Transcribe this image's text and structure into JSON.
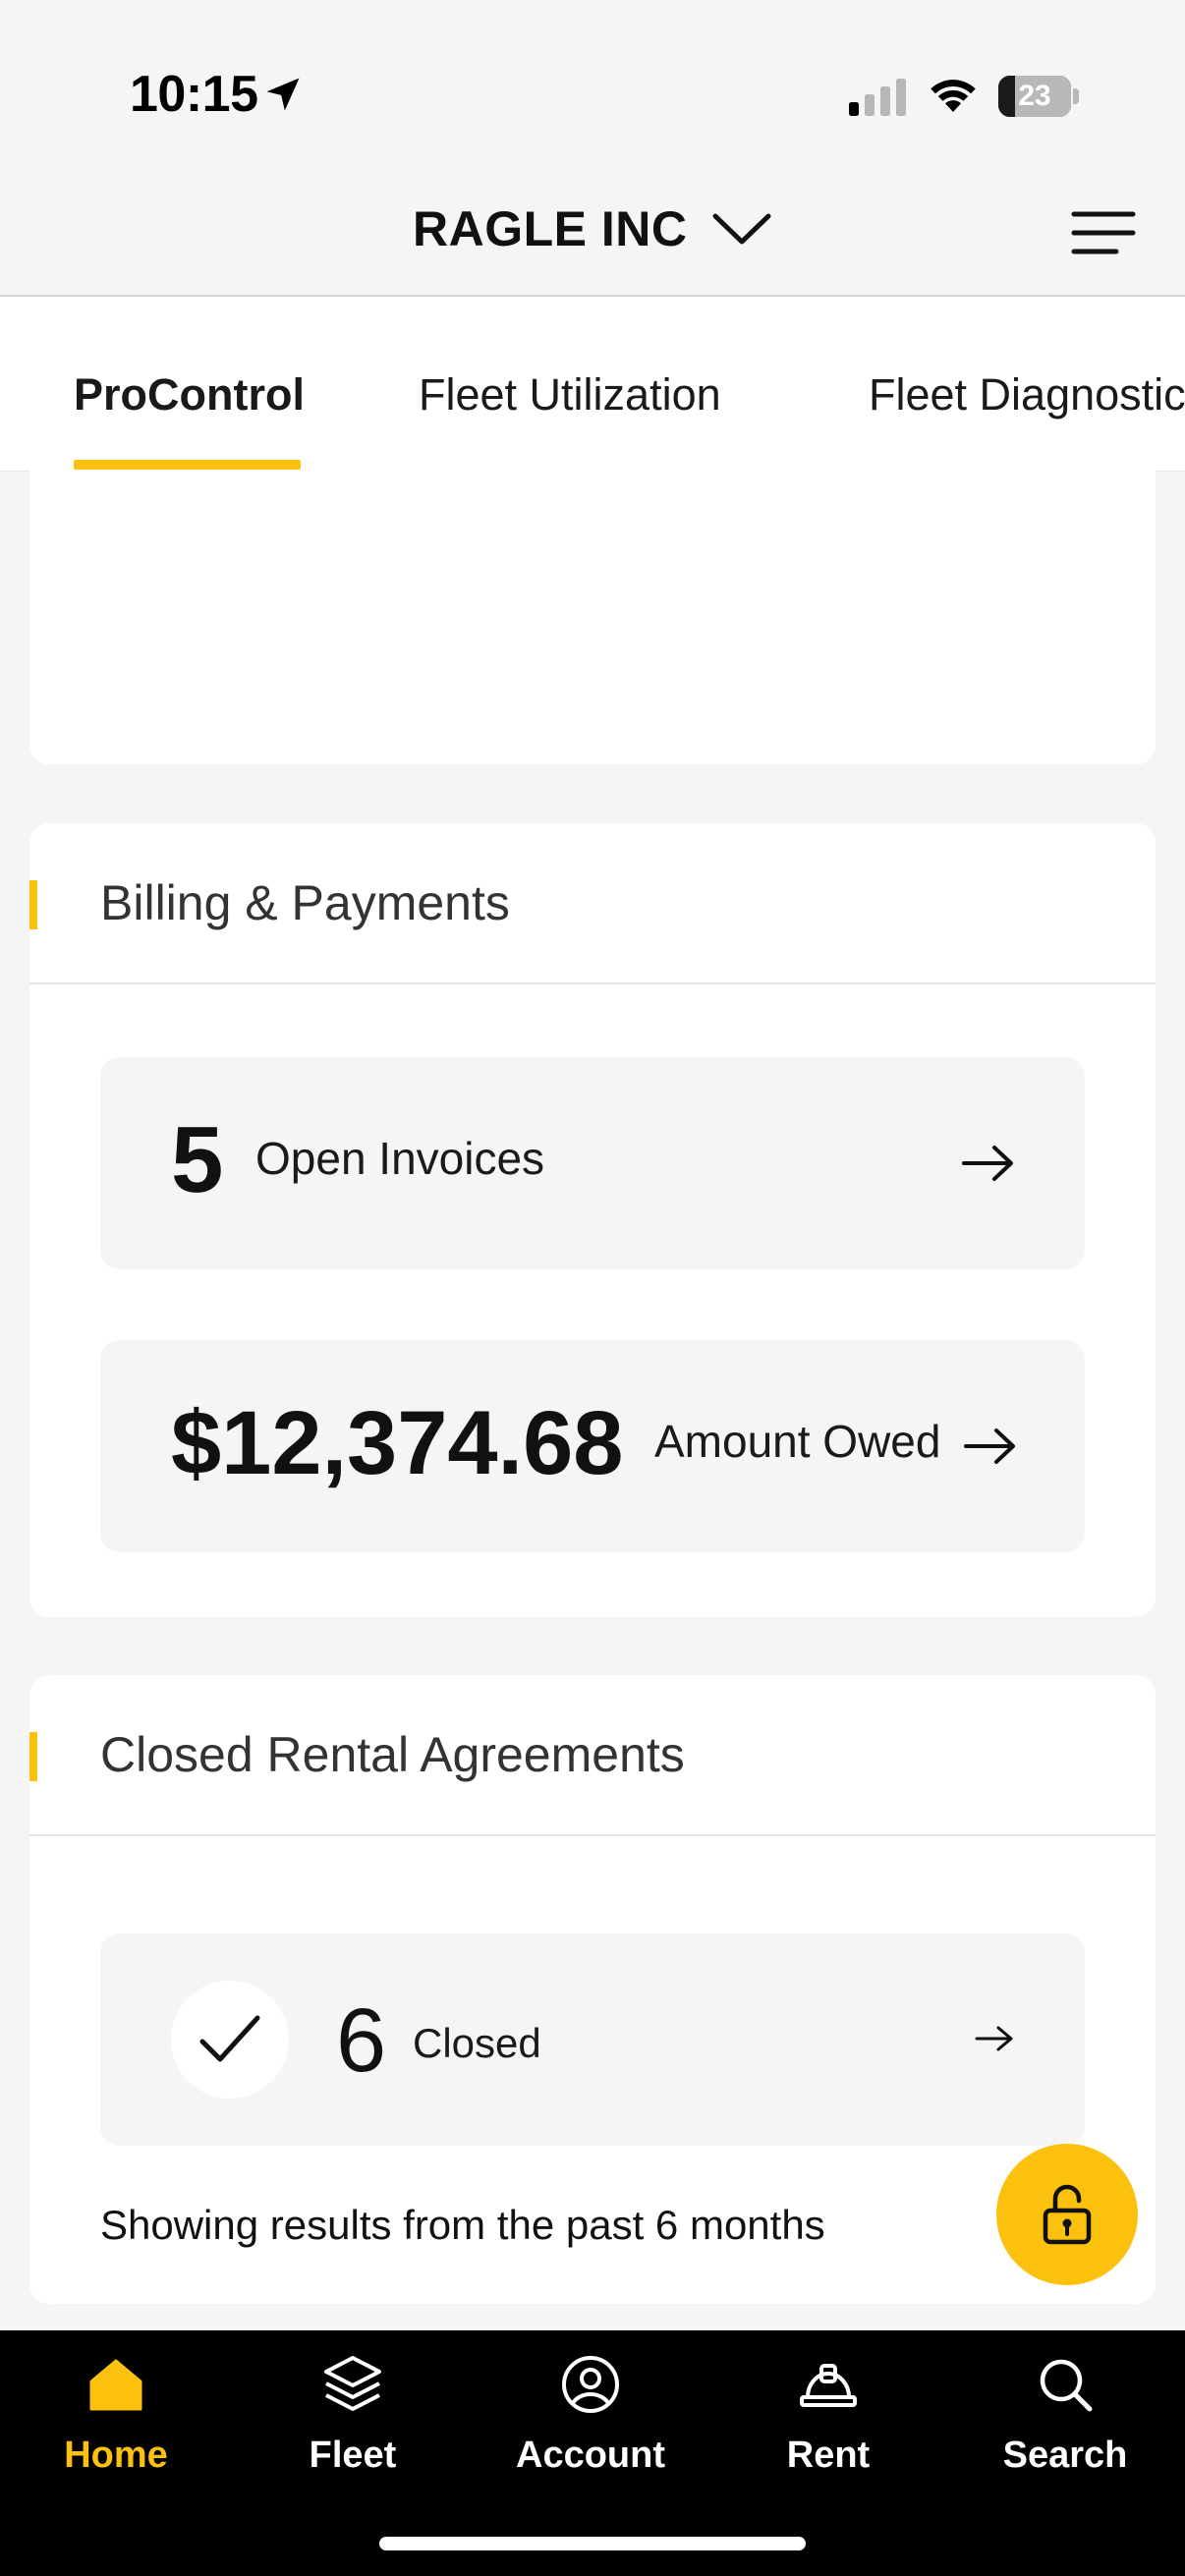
{
  "status_bar": {
    "time": "10:15",
    "battery": "23",
    "battery_percent": 23
  },
  "header": {
    "company_name": "RAGLE INC"
  },
  "tabs": [
    {
      "label": "ProControl",
      "active": true
    },
    {
      "label": "Fleet Utilization",
      "active": false
    },
    {
      "label": "Fleet Diagnostics",
      "active": false
    }
  ],
  "billing": {
    "title": "Billing & Payments",
    "open_invoices_count": "5",
    "open_invoices_label": "Open Invoices",
    "amount_owed": "$12,374.68",
    "amount_owed_label": "Amount Owed"
  },
  "closed_rentals": {
    "title": "Closed Rental Agreements",
    "count": "6",
    "label": "Closed",
    "note": "Showing results from the past 6 months"
  },
  "bottom_nav": [
    {
      "label": "Home",
      "icon": "home-icon",
      "active": true
    },
    {
      "label": "Fleet",
      "icon": "layers-icon",
      "active": false
    },
    {
      "label": "Account",
      "icon": "account-icon",
      "active": false
    },
    {
      "label": "Rent",
      "icon": "hard-hat-icon",
      "active": false
    },
    {
      "label": "Search",
      "icon": "search-icon",
      "active": false
    }
  ],
  "colors": {
    "accent": "#fcc10f",
    "nav_background": "#000000",
    "page_background": "#f5f5f5"
  }
}
